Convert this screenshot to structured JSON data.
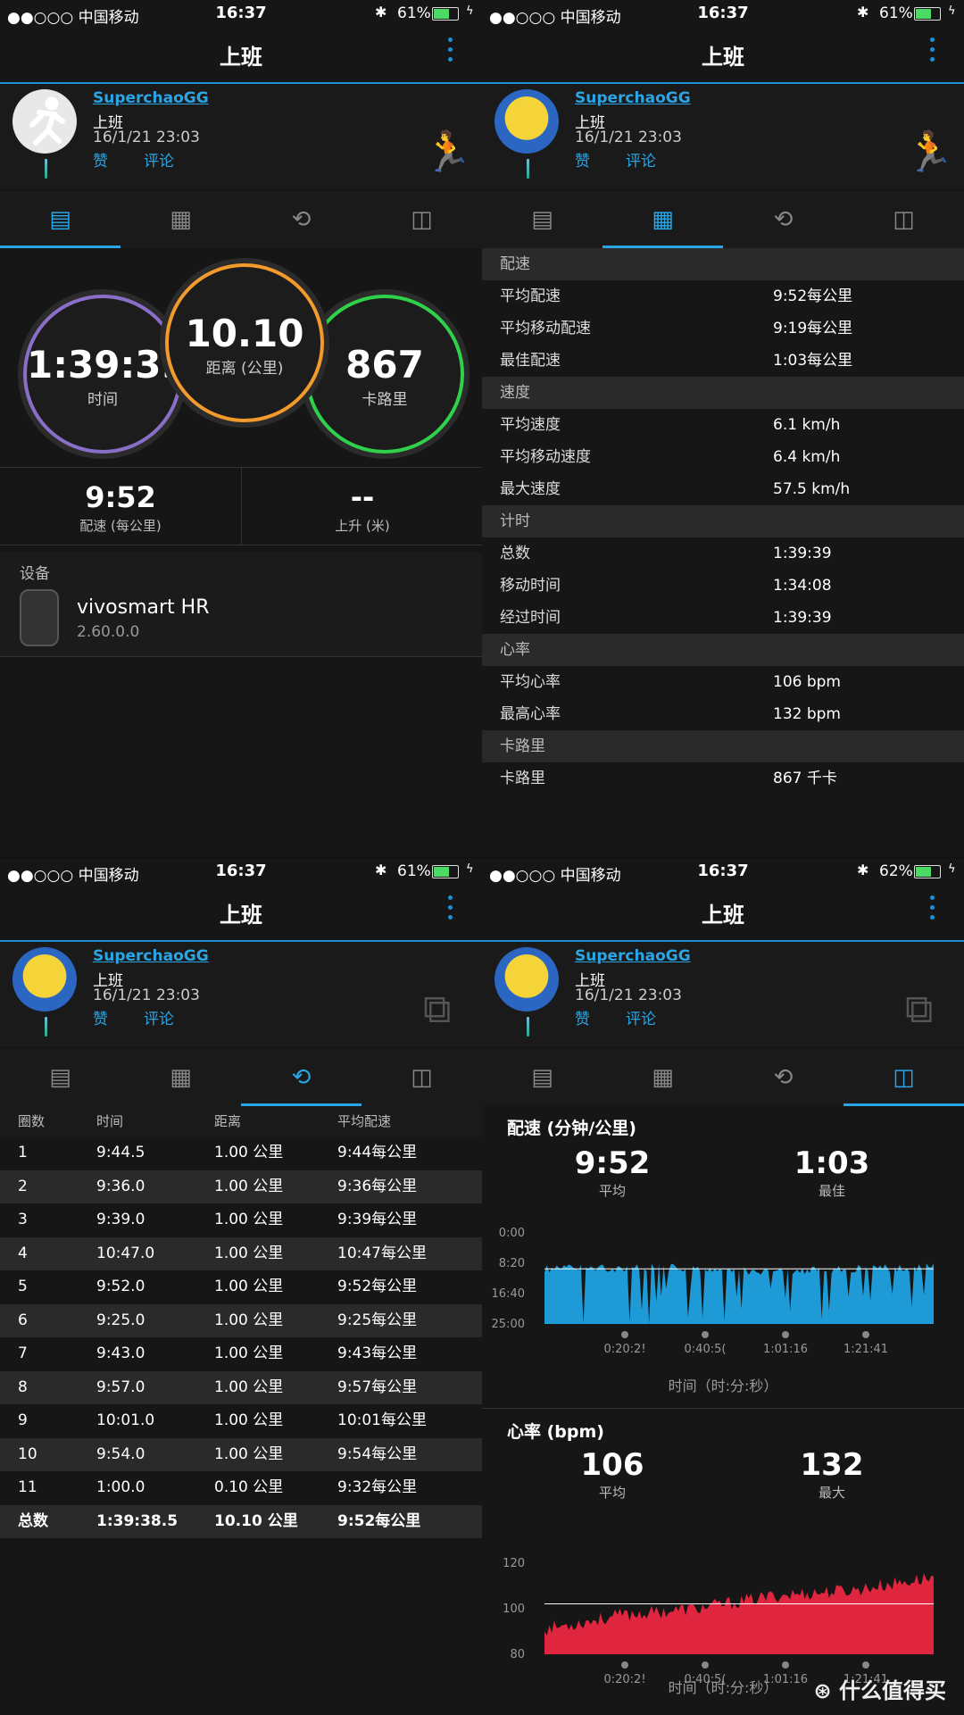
{
  "activity_title": "上班",
  "user": {
    "name": "SuperchaoGG",
    "activity": "上班",
    "date": "16/1/21 23:03",
    "like": "赞",
    "comment": "评论"
  },
  "status": {
    "p1": {
      "carrier": "●●○○○ 中国移动",
      "time": "16:37",
      "battery": "61%"
    },
    "p2": {
      "carrier": "●●○○○ 中国移动",
      "time": "16:37",
      "battery": "61%"
    },
    "p3": {
      "carrier": "●●○○○ 中国移动",
      "time": "16:37",
      "battery": "61%"
    },
    "p4": {
      "carrier": "●●○○○ 中国移动",
      "time": "16:37",
      "battery": "62%"
    }
  },
  "summary": {
    "time": {
      "value": "1:39:39",
      "label": "时间"
    },
    "distance": {
      "value": "10.10",
      "label": "距离 (公里)"
    },
    "calories": {
      "value": "867",
      "label": "卡路里"
    },
    "pace": {
      "value": "9:52",
      "label": "配速 (每公里)"
    },
    "ascent": {
      "value": "--",
      "label": "上升 (米)"
    },
    "device_header": "设备",
    "device_name": "vivosmart HR",
    "device_version": "2.60.0.0"
  },
  "details": [
    {
      "header": "配速",
      "rows": [
        [
          "平均配速",
          "9:52每公里"
        ],
        [
          "平均移动配速",
          "9:19每公里"
        ],
        [
          "最佳配速",
          "1:03每公里"
        ]
      ]
    },
    {
      "header": "速度",
      "rows": [
        [
          "平均速度",
          "6.1 km/h"
        ],
        [
          "平均移动速度",
          "6.4 km/h"
        ],
        [
          "最大速度",
          "57.5 km/h"
        ]
      ]
    },
    {
      "header": "计时",
      "rows": [
        [
          "总数",
          "1:39:39"
        ],
        [
          "移动时间",
          "1:34:08"
        ],
        [
          "经过时间",
          "1:39:39"
        ]
      ]
    },
    {
      "header": "心率",
      "rows": [
        [
          "平均心率",
          "106 bpm"
        ],
        [
          "最高心率",
          "132 bpm"
        ]
      ]
    },
    {
      "header": "卡路里",
      "rows": [
        [
          "卡路里",
          "867 千卡"
        ]
      ]
    }
  ],
  "laps": {
    "columns": [
      "圈数",
      "时间",
      "距离",
      "平均配速"
    ],
    "rows": [
      [
        "1",
        "9:44.5",
        "1.00 公里",
        "9:44每公里"
      ],
      [
        "2",
        "9:36.0",
        "1.00 公里",
        "9:36每公里"
      ],
      [
        "3",
        "9:39.0",
        "1.00 公里",
        "9:39每公里"
      ],
      [
        "4",
        "10:47.0",
        "1.00 公里",
        "10:47每公里"
      ],
      [
        "5",
        "9:52.0",
        "1.00 公里",
        "9:52每公里"
      ],
      [
        "6",
        "9:25.0",
        "1.00 公里",
        "9:25每公里"
      ],
      [
        "7",
        "9:43.0",
        "1.00 公里",
        "9:43每公里"
      ],
      [
        "8",
        "9:57.0",
        "1.00 公里",
        "9:57每公里"
      ],
      [
        "9",
        "10:01.0",
        "1.00 公里",
        "10:01每公里"
      ],
      [
        "10",
        "9:54.0",
        "1.00 公里",
        "9:54每公里"
      ],
      [
        "11",
        "1:00.0",
        "0.10 公里",
        "9:32每公里"
      ]
    ],
    "total": [
      "总数",
      "1:39:38.5",
      "10.10 公里",
      "9:52每公里"
    ]
  },
  "charts": {
    "pace": {
      "title": "配速 (分钟/公里)",
      "avg": "9:52",
      "avg_label": "平均",
      "best": "1:03",
      "best_label": "最佳",
      "yticks": [
        "0:00",
        "8:20",
        "16:40",
        "25:00"
      ],
      "xticks": [
        "0:20:2!",
        "0:40:5(",
        "1:01:16",
        "1:21:41"
      ],
      "xlabel": "时间（时:分:秒）",
      "color": "#1e9ad6"
    },
    "hr": {
      "title": "心率 (bpm)",
      "avg": "106",
      "avg_label": "平均",
      "max": "132",
      "max_label": "最大",
      "yticks": [
        "120",
        "100",
        "80"
      ],
      "xticks": [
        "0:20:2!",
        "0:40:5(",
        "1:01:16",
        "1:21:41"
      ],
      "xlabel": "时间（时:分:秒）",
      "color": "#e0253f"
    }
  },
  "chart_data": [
    {
      "type": "area",
      "title": "配速 (分钟/公里)",
      "ylabel": "",
      "xlabel": "时间（时:分:秒）",
      "ylim": [
        0,
        25
      ],
      "avg_line": 9.87,
      "x": [
        "0:00",
        "0:20",
        "0:40",
        "1:01",
        "1:21",
        "1:39"
      ],
      "values": [
        9.9,
        9.6,
        9.7,
        10.8,
        9.9,
        9.5
      ]
    },
    {
      "type": "area",
      "title": "心率 (bpm)",
      "ylabel": "",
      "xlabel": "时间（时:分:秒）",
      "ylim": [
        70,
        135
      ],
      "avg_line": 106,
      "x": [
        "0:00",
        "0:20",
        "0:40",
        "1:01",
        "1:21",
        "1:39"
      ],
      "values": [
        88,
        98,
        103,
        112,
        116,
        125
      ]
    }
  ],
  "watermark": "值 什么值得买"
}
